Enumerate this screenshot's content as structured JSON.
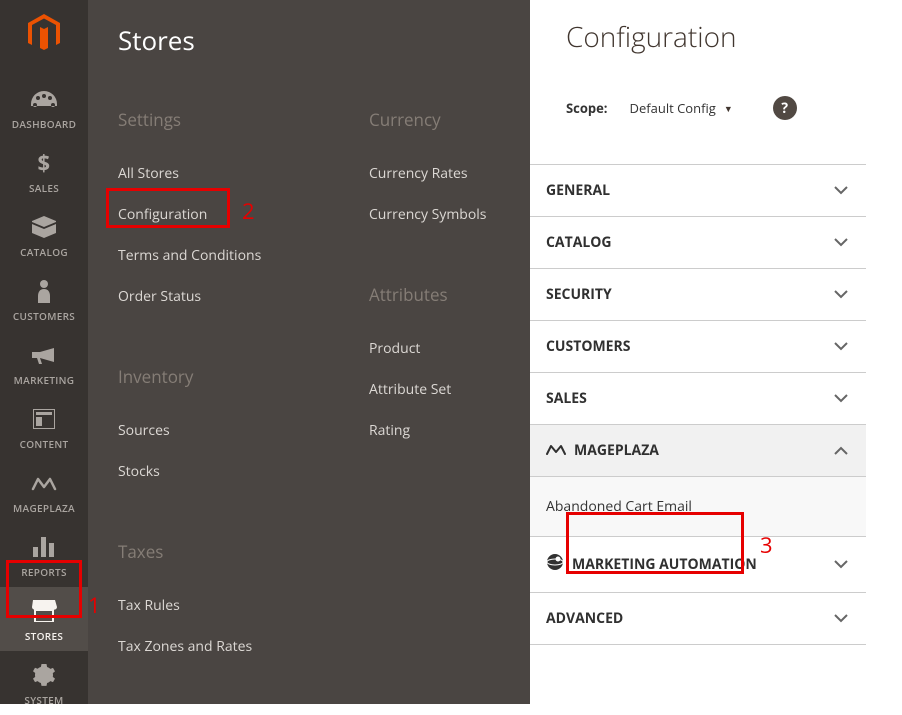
{
  "sidebar": {
    "items": [
      {
        "label": "DASHBOARD"
      },
      {
        "label": "SALES"
      },
      {
        "label": "CATALOG"
      },
      {
        "label": "CUSTOMERS"
      },
      {
        "label": "MARKETING"
      },
      {
        "label": "CONTENT"
      },
      {
        "label": "MAGEPLAZA"
      },
      {
        "label": "REPORTS"
      },
      {
        "label": "STORES"
      },
      {
        "label": "SYSTEM"
      }
    ]
  },
  "submenu": {
    "title": "Stores",
    "groups": {
      "settings": {
        "heading": "Settings",
        "items": [
          "All Stores",
          "Configuration",
          "Terms and Conditions",
          "Order Status"
        ]
      },
      "inventory": {
        "heading": "Inventory",
        "items": [
          "Sources",
          "Stocks"
        ]
      },
      "taxes": {
        "heading": "Taxes",
        "items": [
          "Tax Rules",
          "Tax Zones and Rates"
        ]
      },
      "currency": {
        "heading": "Currency",
        "items": [
          "Currency Rates",
          "Currency Symbols"
        ]
      },
      "attributes": {
        "heading": "Attributes",
        "items": [
          "Product",
          "Attribute Set",
          "Rating"
        ]
      }
    }
  },
  "main": {
    "title": "Configuration",
    "scope_label": "Scope:",
    "scope_value": "Default Config",
    "help_glyph": "?",
    "sections": {
      "general": "GENERAL",
      "catalog": "CATALOG",
      "security": "SECURITY",
      "customers": "CUSTOMERS",
      "sales": "SALES",
      "mageplaza": "MAGEPLAZA",
      "mageplaza_sub": "Abandoned Cart Email",
      "marketing_automation": "MARKETING AUTOMATION",
      "advanced": "ADVANCED"
    }
  },
  "annotations": {
    "num1": "1",
    "num2": "2",
    "num3": "3"
  }
}
